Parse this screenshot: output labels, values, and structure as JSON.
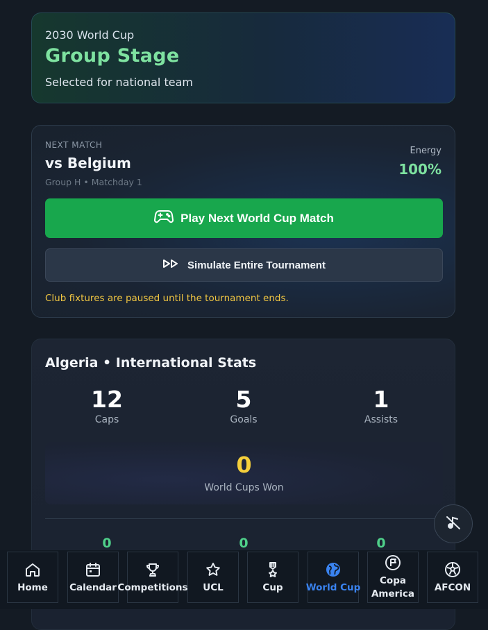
{
  "hero": {
    "event": "2030 World Cup",
    "stage": "Group Stage",
    "status": "Selected for national team"
  },
  "next_match": {
    "label": "NEXT MATCH",
    "opponent": "vs Belgium",
    "details": "Group H • Matchday 1",
    "energy_label": "Energy",
    "energy_value": "100%",
    "play_button": "Play Next World Cup Match",
    "simulate_button": "Simulate Entire Tournament",
    "note": "Club fixtures are paused until the tournament ends."
  },
  "stats": {
    "title": "Algeria • International Stats",
    "items": [
      {
        "value": "12",
        "label": "Caps"
      },
      {
        "value": "5",
        "label": "Goals"
      },
      {
        "value": "1",
        "label": "Assists"
      }
    ],
    "world_cups_value": "0",
    "world_cups_label": "World Cups Won",
    "secondary": [
      "0",
      "0",
      "0"
    ]
  },
  "nav": {
    "items": [
      {
        "label": "Home",
        "icon": "home-icon"
      },
      {
        "label": "Calendar",
        "icon": "calendar-icon"
      },
      {
        "label": "Competitions",
        "icon": "trophy-icon"
      },
      {
        "label": "UCL",
        "icon": "star-icon"
      },
      {
        "label": "Cup",
        "icon": "medal-icon"
      },
      {
        "label": "World Cup",
        "icon": "globe-icon"
      },
      {
        "label": "Copa America",
        "icon": "flag-icon"
      },
      {
        "label": "AFCON",
        "icon": "ball-icon"
      }
    ],
    "active": "World Cup"
  },
  "colors": {
    "accent_green": "#18a74d",
    "highlight_green": "#7ee2a0",
    "warning_yellow": "#f0c642",
    "active_blue": "#3a83f0"
  }
}
